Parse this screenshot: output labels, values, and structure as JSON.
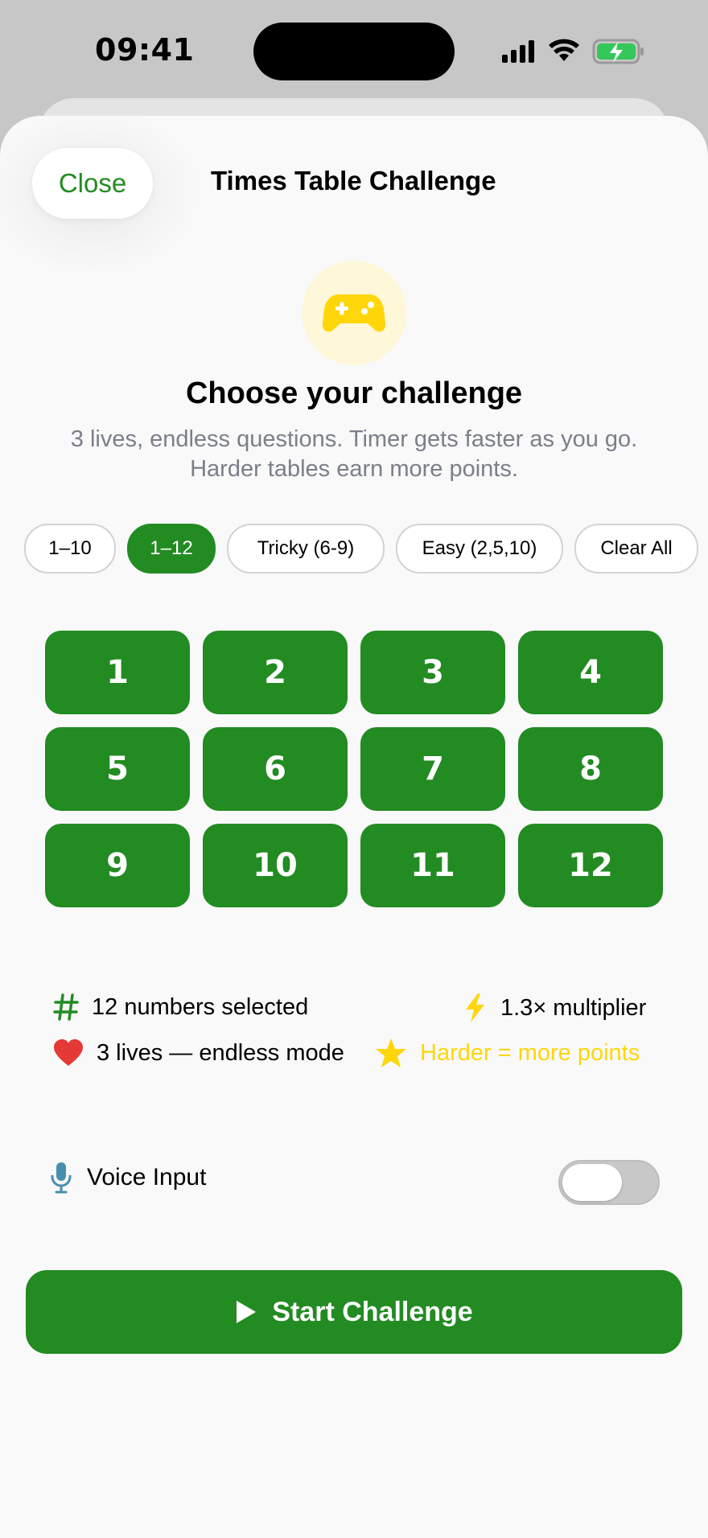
{
  "status_bar": {
    "time": "09:41"
  },
  "header": {
    "close_label": "Close",
    "title": "Times Table Challenge"
  },
  "hero": {
    "icon": "gamepad-icon",
    "headline": "Choose your challenge",
    "subtitle_line1": "3 lives, endless questions. Timer gets faster as you go.",
    "subtitle_line2": "Harder tables earn more points."
  },
  "presets": [
    {
      "label": "1–10",
      "selected": false
    },
    {
      "label": "1–12",
      "selected": true
    },
    {
      "label": "Tricky (6-9)",
      "selected": false
    },
    {
      "label": "Easy (2,5,10)",
      "selected": false
    },
    {
      "label": "Clear All",
      "selected": false
    }
  ],
  "numbers": [
    "1",
    "2",
    "3",
    "4",
    "5",
    "6",
    "7",
    "8",
    "9",
    "10",
    "11",
    "12"
  ],
  "stats": {
    "selected_count": "12 numbers selected",
    "multiplier": "1.3× multiplier",
    "lives": "3 lives — endless mode",
    "points_hint": "Harder = more points"
  },
  "voice": {
    "label": "Voice Input",
    "enabled": false
  },
  "start": {
    "label": "Start Challenge"
  },
  "colors": {
    "accent": "#228b22",
    "gold": "#ffd60a",
    "heart": "#e53935",
    "mic": "#4a8fb0",
    "subtitle": "#7b7f8a"
  }
}
